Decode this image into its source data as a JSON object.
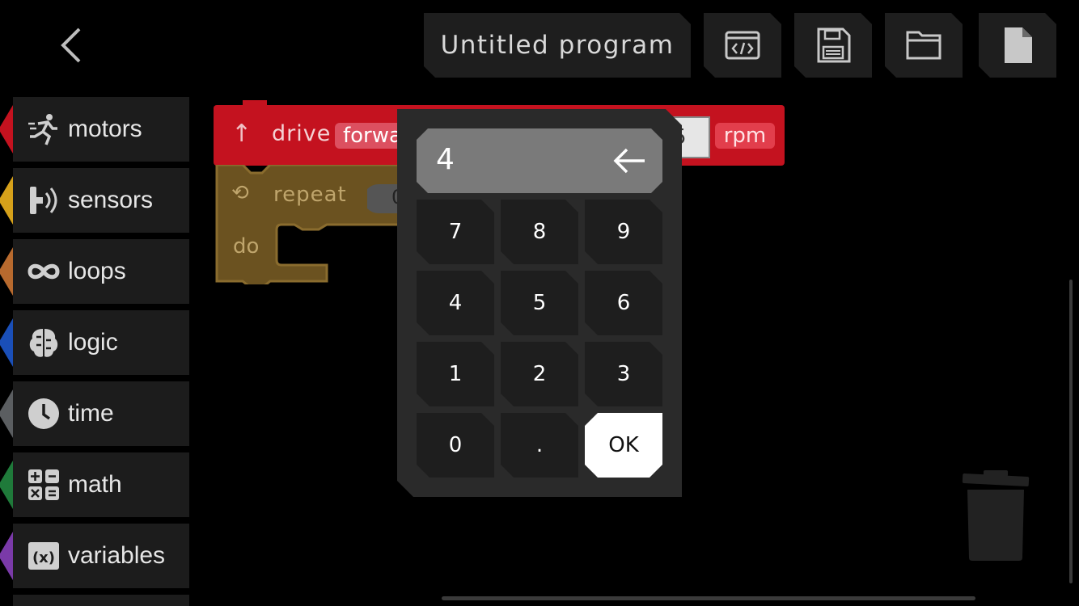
{
  "header": {
    "program_title": "Untitled program",
    "buttons": [
      "code-view",
      "save",
      "open-folder",
      "new-file"
    ]
  },
  "categories": [
    {
      "label": "motors",
      "color": "#c4121f",
      "icon": "running-icon"
    },
    {
      "label": "sensors",
      "color": "#d6a11a",
      "icon": "sensor-icon"
    },
    {
      "label": "loops",
      "color": "#b86a2e",
      "icon": "infinity-icon"
    },
    {
      "label": "logic",
      "color": "#1a4fb8",
      "icon": "brain-icon"
    },
    {
      "label": "time",
      "color": "#5b5e61",
      "icon": "clock-icon"
    },
    {
      "label": "math",
      "color": "#1f7a3a",
      "icon": "calculator-icon"
    },
    {
      "label": "variables",
      "color": "#7a3aa8",
      "icon": "variable-icon"
    }
  ],
  "blocks": {
    "drive": {
      "label": "drive",
      "direction": "forwa",
      "value_partial": "5",
      "unit": "rpm"
    },
    "repeat": {
      "label": "repeat",
      "count_partial": "0",
      "do_label": "do"
    }
  },
  "keypad": {
    "display_value": "4",
    "keys": [
      "7",
      "8",
      "9",
      "4",
      "5",
      "6",
      "1",
      "2",
      "3",
      "0",
      "."
    ],
    "ok_label": "OK"
  }
}
